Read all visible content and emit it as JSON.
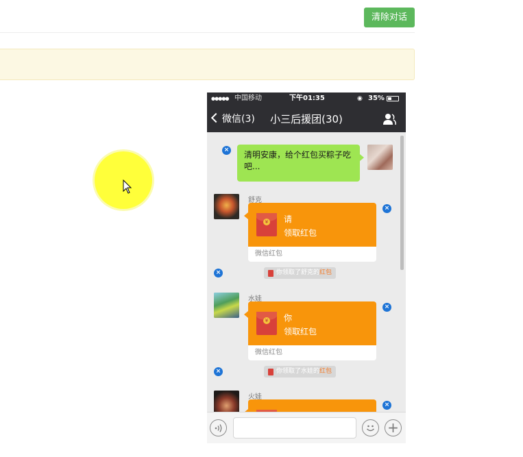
{
  "toolbar": {
    "clear_label": "清除对话"
  },
  "phone": {
    "statusbar": {
      "signal": "●●●●●",
      "carrier": "中国移动",
      "wifi_icon": "wifi-icon",
      "time": "下午01:35",
      "battery": "35%"
    },
    "nav": {
      "back_label": "微信(3)",
      "title": "小三后援团(30)"
    },
    "messages": {
      "self_text": "清明安康，给个红包买粽子吃吧...",
      "rp1": {
        "sender": "舒克",
        "message": "请",
        "action": "领取红包",
        "footer": "微信红包"
      },
      "sys1": {
        "prefix": "你领取了舒克的",
        "highlight": "红包"
      },
      "rp2": {
        "sender": "水娃",
        "message": "你",
        "action": "领取红包",
        "footer": "微信红包"
      },
      "sys2": {
        "prefix": "你领取了水娃的",
        "highlight": "红包"
      },
      "rp3": {
        "sender": "火娃"
      }
    },
    "delete_glyph": "×"
  },
  "colors": {
    "accent_green": "#5cb85c",
    "redpack_orange": "#f8950b",
    "highlight_yellow": "#ffff3a",
    "delete_blue": "#1e74d6"
  }
}
